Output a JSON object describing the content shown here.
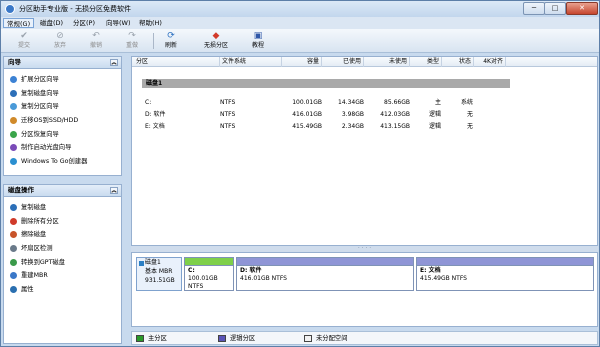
{
  "window": {
    "title": "分区助手专业版 - 无损分区免费软件",
    "min_label": "─",
    "max_label": "□",
    "close_label": "✕"
  },
  "menu": [
    "常规(G)",
    "磁盘(D)",
    "分区(P)",
    "向导(W)",
    "帮助(H)"
  ],
  "toolbar": [
    {
      "label": "提交",
      "icon": "check-icon",
      "enabled": false
    },
    {
      "label": "放弃",
      "icon": "discard-icon",
      "enabled": false
    },
    {
      "label": "撤销",
      "icon": "undo-icon",
      "enabled": false
    },
    {
      "label": "重做",
      "icon": "redo-icon",
      "enabled": false
    },
    {
      "label": "刷新",
      "icon": "refresh-icon",
      "enabled": true
    },
    {
      "label": "无损分区",
      "icon": "partition-icon",
      "enabled": true
    },
    {
      "label": "教程",
      "icon": "tutorial-icon",
      "enabled": true
    }
  ],
  "wizard_panel": {
    "title": "向导",
    "items": [
      "扩展分区向导",
      "复制磁盘向导",
      "复制分区向导",
      "迁移OS到SSD/HDD",
      "分区恢复向导",
      "制作启动光盘向导",
      "Windows To Go创建器"
    ]
  },
  "disk_ops_panel": {
    "title": "磁盘操作",
    "items": [
      "复制磁盘",
      "删除所有分区",
      "擦除磁盘",
      "坏扇区检测",
      "转换到GPT磁盘",
      "重建MBR",
      "属性"
    ]
  },
  "columns": [
    "分区",
    "文件系统",
    "容量",
    "已使用",
    "未使用",
    "类型",
    "状态",
    "4K对齐"
  ],
  "disk_row": "磁盘1",
  "partitions": [
    {
      "name": "C:",
      "fs": "NTFS",
      "capacity": "100.01GB",
      "used": "14.34GB",
      "free": "85.66GB",
      "type": "主",
      "status": "系统"
    },
    {
      "name": "D: 软件",
      "fs": "NTFS",
      "capacity": "416.01GB",
      "used": "3.98GB",
      "free": "412.03GB",
      "type": "逻辑",
      "status": "无"
    },
    {
      "name": "E: 文档",
      "fs": "NTFS",
      "capacity": "415.49GB",
      "used": "2.34GB",
      "free": "413.15GB",
      "type": "逻辑",
      "status": "无"
    }
  ],
  "diskmap": {
    "disk": {
      "name": "磁盘1",
      "type": "基本 MBR",
      "size": "931.51GB"
    },
    "blocks": [
      {
        "name": "C:",
        "size": "100.01GB NTFS",
        "used_fraction": 0.14,
        "bar_color": "#7fd04a"
      },
      {
        "name": "D: 软件",
        "size": "416.01GB NTFS",
        "used_fraction": 0.01,
        "bar_color": "#8f95d6"
      },
      {
        "name": "E: 文档",
        "size": "415.49GB NTFS",
        "used_fraction": 0.01,
        "bar_color": "#8f95d6"
      }
    ]
  },
  "legend": [
    {
      "label": "主分区",
      "color": "#2a9a2a"
    },
    {
      "label": "逻辑分区",
      "color": "#5b55b8"
    },
    {
      "label": "未分配空间",
      "color": "#f2f2f2"
    }
  ]
}
